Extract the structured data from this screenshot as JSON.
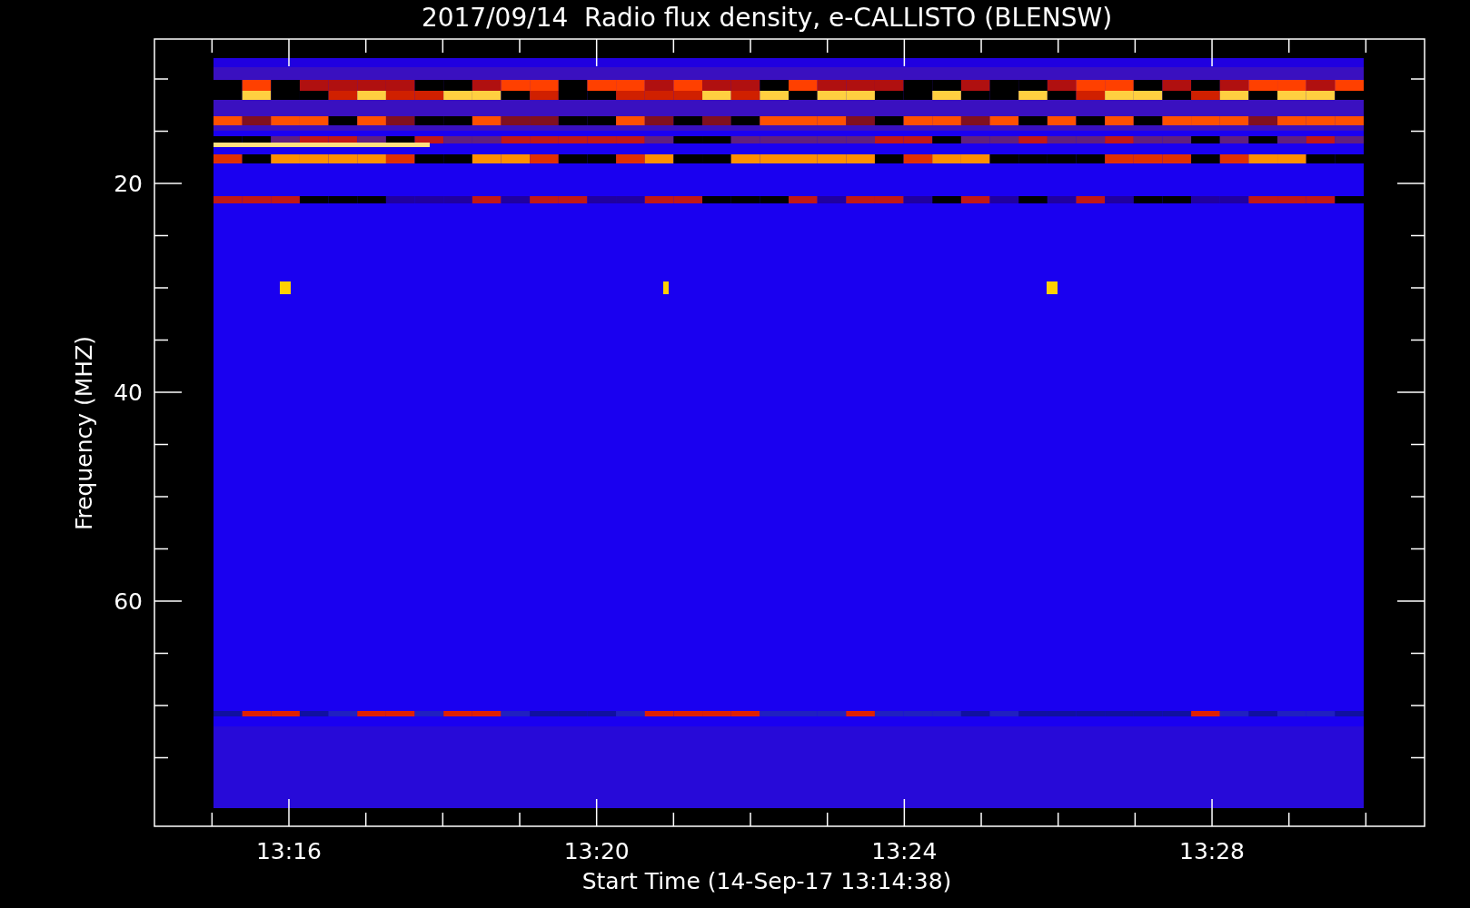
{
  "title": "2017/09/14  Radio flux density, e-CALLISTO (BLENSW)",
  "chart": {
    "xlabel": "Start Time (14-Sep-17 13:14:38)",
    "ylabel": "Frequency (MHZ)",
    "yticks": [
      "20",
      "40",
      "60"
    ],
    "xticks": [
      "13:16",
      "13:20",
      "13:24",
      "13:28"
    ]
  }
}
